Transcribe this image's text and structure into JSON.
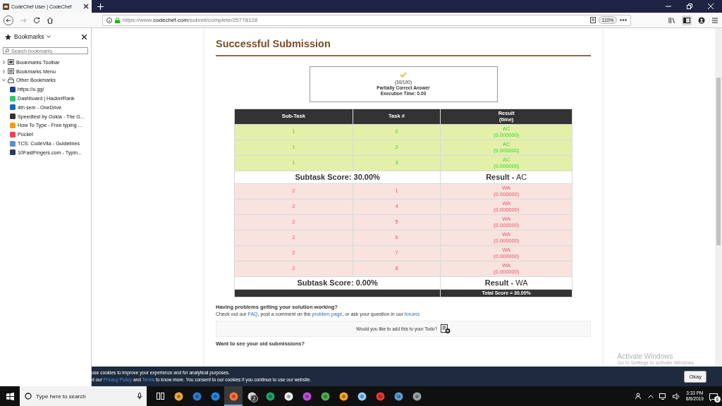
{
  "browser": {
    "tab_title": "CodeChef User | CodeChef",
    "url_prefix": "https://www.",
    "url_domain": "codechef.com",
    "url_path": "/submit/complete/25778128",
    "zoom": "110%"
  },
  "sidebar": {
    "title": "Bookmarks",
    "search_placeholder": "Search bookmarks",
    "items": [
      {
        "label": "Bookmarks Toolbar",
        "kind": "folder",
        "expanded": false
      },
      {
        "label": "Bookmarks Menu",
        "kind": "folder",
        "expanded": false
      },
      {
        "label": "Other Bookmarks",
        "kind": "folder",
        "expanded": true,
        "children": [
          {
            "label": "https://u.gg/",
            "kind": "bookmark",
            "color": "#1c3f8c"
          },
          {
            "label": "Dashboard | HackerRank",
            "kind": "bookmark",
            "color": "#2ec866"
          },
          {
            "label": "4th sem - OneDrive",
            "kind": "bookmark",
            "color": "#1565c0"
          },
          {
            "label": "Speedtest by Ookla - The G...",
            "kind": "bookmark",
            "color": "#333333"
          },
          {
            "label": "How To Type - Free typing ...",
            "kind": "bookmark",
            "color": "#f39c12"
          },
          {
            "label": "Pocket",
            "kind": "bookmark",
            "color": "#ef4056"
          },
          {
            "label": "TCS: CodeVita - Guidelines",
            "kind": "bookmark",
            "color": "#5b8fc7"
          },
          {
            "label": "10FastFingers.com - Typin...",
            "kind": "bookmark",
            "color": "#2b3a55"
          }
        ]
      }
    ]
  },
  "page": {
    "title": "Successful Submission",
    "verdict": {
      "score": "(30/100)",
      "status": "Partially Correct Answer",
      "time": "Execution Time: 0.00"
    },
    "table": {
      "columns": [
        {
          "label": "Sub-Task"
        },
        {
          "label": "Task #"
        },
        {
          "label": "Result",
          "sublabel": "(time)"
        }
      ],
      "rows": [
        {
          "kind": "pass",
          "subtask": "1",
          "task": "0",
          "result": "AC",
          "time": "(0.000000)"
        },
        {
          "kind": "pass",
          "subtask": "1",
          "task": "2",
          "result": "AC",
          "time": "(0.000000)"
        },
        {
          "kind": "pass",
          "subtask": "1",
          "task": "3",
          "result": "AC",
          "time": "(0.000000)"
        },
        {
          "kind": "summary",
          "score": "Subtask Score: 30.00%",
          "result": "**Result -** AC"
        },
        {
          "kind": "fail",
          "subtask": "2",
          "task": "1",
          "result": "WA",
          "time": "(0.000000)"
        },
        {
          "kind": "fail",
          "subtask": "2",
          "task": "4",
          "result": "WA",
          "time": "(0.000000)"
        },
        {
          "kind": "fail",
          "subtask": "2",
          "task": "5",
          "result": "WA",
          "time": "(0.000000)"
        },
        {
          "kind": "fail",
          "subtask": "2",
          "task": "6",
          "result": "WA",
          "time": "(0.000000)"
        },
        {
          "kind": "fail",
          "subtask": "2",
          "task": "7",
          "result": "WA",
          "time": "(0.000000)"
        },
        {
          "kind": "fail",
          "subtask": "2",
          "task": "8",
          "result": "WA",
          "time": "(0.000000)"
        },
        {
          "kind": "summary",
          "score": "Subtask Score: 0.00%",
          "result": "**Result -** WA"
        }
      ],
      "total": "Total Score = 30.00%"
    },
    "help_heading": "Having problems getting your solution working?",
    "help_text": [
      {
        "kind": "text",
        "text": "Check out our "
      },
      {
        "kind": "link",
        "text": "FAQ"
      },
      {
        "kind": "text",
        "text": ", post a comment on the "
      },
      {
        "kind": "link",
        "text": "problem page"
      },
      {
        "kind": "text",
        "text": ", or ask your question in our "
      },
      {
        "kind": "link",
        "text": "forums"
      }
    ],
    "todo_prompt": "Would you like to add this to your Todo?",
    "old_heading": "Want to see your old submissions?"
  },
  "cookie_banner": {
    "line_1": [
      {
        "kind": "text",
        "text": "use cookies to improve your experience and for analytical purposes."
      }
    ],
    "line_2": [
      {
        "kind": "text",
        "text": "d our "
      },
      {
        "kind": "link",
        "text": "Privacy Policy"
      },
      {
        "kind": "text",
        "text": " and "
      },
      {
        "kind": "link",
        "text": "Terms"
      },
      {
        "kind": "text",
        "text": " to know more. You consent to our cookies if you continue to use our website."
      }
    ],
    "button": "Okay"
  },
  "activation": {
    "title": "Activate Windows",
    "hint": "Go to Settings to activate Windows."
  },
  "taskbar": {
    "search_placeholder": "Type here to search",
    "apps": [
      {
        "color": "#e8a93a",
        "selected": false
      },
      {
        "color": "#2a7bd4",
        "selected": false
      },
      {
        "color": "#1e88e5",
        "selected": false
      },
      {
        "color": "#ff7139",
        "selected": true
      },
      {
        "color": "#dddddd",
        "selected": false,
        "badge": "2"
      },
      {
        "color": "#1fa463",
        "selected": false
      },
      {
        "color": "#eeeeee",
        "selected": false
      },
      {
        "color": "#c04fd8",
        "selected": false
      },
      {
        "color": "#4caf50",
        "selected": false
      },
      {
        "color": "#f5a623",
        "selected": false
      },
      {
        "color": "#90caf9",
        "selected": false
      },
      {
        "color": "#e53935",
        "selected": false
      },
      {
        "color": "#5c9ad6",
        "selected": false
      },
      {
        "color": "#9aa0a6",
        "selected": false
      }
    ],
    "time": "3:33 PM",
    "date": "8/8/2019",
    "notifications": "6"
  }
}
